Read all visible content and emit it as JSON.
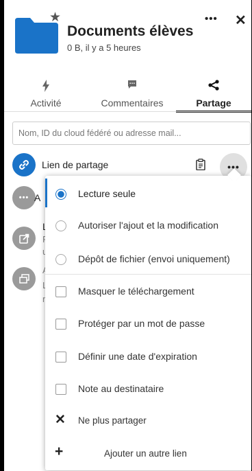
{
  "header": {
    "title": "Documents élèves",
    "subtitle": "0 B, il y a 5 heures",
    "menu_label": "•••",
    "close_label": "✕",
    "folder_color": "#1a73c8"
  },
  "tabs": [
    {
      "label": "Activité",
      "icon": "bolt-icon"
    },
    {
      "label": "Commentaires",
      "icon": "comment-icon"
    },
    {
      "label": "Partage",
      "icon": "share-icon",
      "active": true
    }
  ],
  "search": {
    "placeholder": "Nom, ID du cloud fédéré ou adresse mail..."
  },
  "shares": {
    "link": {
      "label": "Lien de partage",
      "more_label": "•••"
    },
    "behind": {
      "row2_initial": "A",
      "row2_dots": "•••",
      "row3_line1": "L",
      "row3_line2": "F",
      "row3_line3": "u",
      "row4_line1": "A",
      "row4_line2": "L",
      "row4_line3": "r"
    }
  },
  "menu": {
    "radio_options": [
      {
        "label": "Lecture seule",
        "selected": true
      },
      {
        "label": "Autoriser l'ajout et la modification",
        "selected": false
      },
      {
        "label": "Dépôt de fichier (envoi uniquement)",
        "selected": false
      }
    ],
    "checkbox_options": [
      {
        "label": "Masquer le téléchargement",
        "checked": false
      },
      {
        "label": "Protéger par un mot de passe",
        "checked": false
      },
      {
        "label": "Définir une date d'expiration",
        "checked": false
      },
      {
        "label": "Note au destinataire",
        "checked": false
      }
    ],
    "unshare": {
      "label": "Ne plus partager",
      "icon": "✕"
    },
    "add_link": {
      "label": "Ajouter un autre lien",
      "icon": "+"
    }
  },
  "colors": {
    "accent": "#1a73c8",
    "avatar_gray": "#9a9a9a"
  }
}
